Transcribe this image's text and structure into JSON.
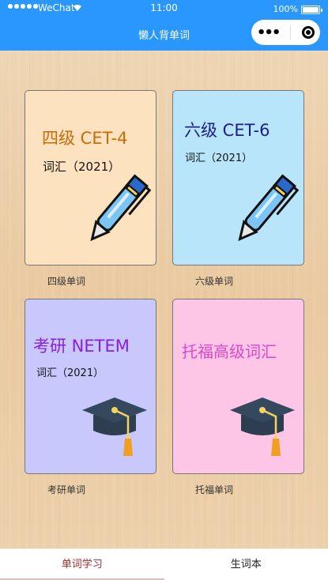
{
  "status": {
    "carrier": "WeChat",
    "time": "11:00",
    "battery_pct": "100%",
    "battery_level": 1.0
  },
  "nav": {
    "title": "懒人背单词"
  },
  "cards": [
    {
      "title": "四级 CET-4",
      "subtitle": "词汇（2021）",
      "caption": "四级单词",
      "bg": "#fde2bf",
      "icon": "pen-icon"
    },
    {
      "title": "六级 CET-6",
      "subtitle": "词汇（2021）",
      "caption": "六级单词",
      "bg": "#b9e5fb",
      "icon": "pen-icon"
    },
    {
      "title": "考研 NETEM",
      "subtitle": "词汇（2021）",
      "caption": "考研单词",
      "bg": "#c8c8fd",
      "icon": "graduation-cap-icon"
    },
    {
      "title": "托福高级词汇",
      "subtitle": "",
      "caption": "托福单词",
      "bg": "#fdc6e6",
      "icon": "graduation-cap-icon"
    }
  ],
  "tabs": [
    {
      "label": "单词学习",
      "active": true
    },
    {
      "label": "生词本",
      "active": false
    }
  ],
  "colors": {
    "nav_bg": "#2a97ff",
    "active_tab": "#9b2b2b"
  }
}
